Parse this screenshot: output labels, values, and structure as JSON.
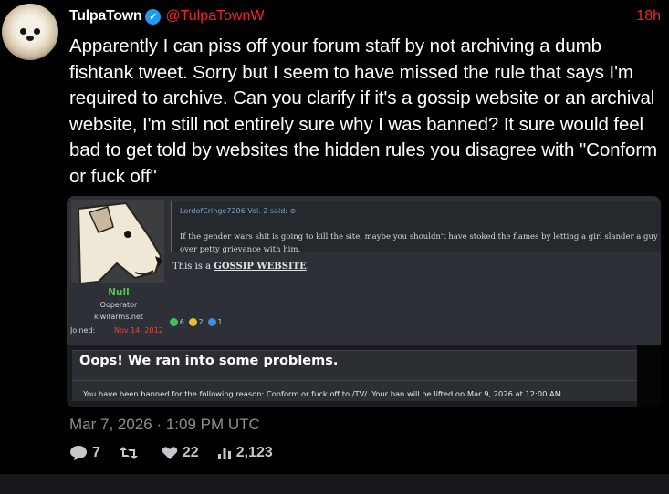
{
  "tweet": {
    "display_name": "TulpaTown",
    "handle": "@TulpaTownW",
    "time_ago": "18h",
    "verified_glyph": "✓",
    "text": "Apparently I can piss off your forum staff by not archiving a dumb fishtank tweet. Sorry but I seem to have missed the rule that says I'm required to archive. Can you clarify if it's a gossip website or an archival website, I'm still not entirely sure why I was banned? It sure would feel bad to get told by websites the hidden rules you disagree with \"Conform or fuck off\"",
    "timestamp": "Mar 7, 2026 · 1:09 PM UTC",
    "stats": {
      "replies": "7",
      "retweets": "",
      "likes": "22",
      "views": "2,123"
    }
  },
  "screenshot": {
    "user": {
      "name": "Null",
      "role": "Ooperator",
      "site": "kiwifarms.net",
      "joined_label": "Joined:",
      "joined_date": "Nov 14, 2012"
    },
    "quote_author": "LordofCringe7206 Vol. 2 said: ⊕",
    "quote_text": "If the gender wars shit is going to kill the site, maybe you shouldn't have stoked the flames by letting a girl slander a guy over petty grievance with him.",
    "reply_prefix": "This is a ",
    "reply_emphasis": "GOSSIP WEBSITE",
    "reply_suffix": ".",
    "reactions": [
      {
        "count": "6",
        "color": "#3fbf5f"
      },
      {
        "count": "2",
        "color": "#e0c030"
      },
      {
        "count": "1",
        "color": "#3b8fe0"
      }
    ],
    "error_title": "Oops! We ran into some problems.",
    "error_message": "You have been banned for the following reason: Conform or fuck off to /TV/. Your ban will be lifted on Mar 9, 2026 at 12:00 AM."
  },
  "colors": {
    "accent_red": "#f4212e",
    "verified_blue": "#1d9bf0",
    "muted_text": "#8b8f94"
  },
  "icons": [
    "verified-badge-icon",
    "reply-icon",
    "retweet-icon",
    "like-icon",
    "views-icon"
  ]
}
